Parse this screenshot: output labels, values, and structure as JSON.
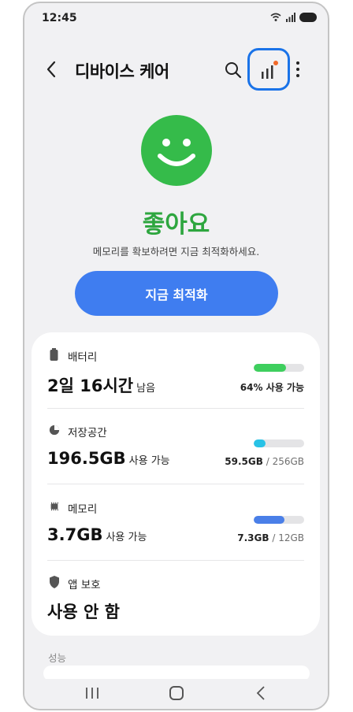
{
  "status_bar": {
    "time": "12:45"
  },
  "app_bar": {
    "title": "디바이스 케어"
  },
  "hero": {
    "status": "좋아요",
    "message": "메모리를 확보하려면 지금 최적화하세요.",
    "button_label": "지금 최적화"
  },
  "items": [
    {
      "label": "배터리",
      "value": "2일 16시간",
      "value_suffix": "남음",
      "info_main": "64% 사용 가능",
      "info_rest": "",
      "fill": 0.64,
      "color": "#3ecf5e"
    },
    {
      "label": "저장공간",
      "value": "196.5GB",
      "value_suffix": "사용 가능",
      "info_main": "59.5GB",
      "info_rest": " / 256GB",
      "fill": 0.23,
      "color": "#28c2e6"
    },
    {
      "label": "메모리",
      "value": "3.7GB",
      "value_suffix": "사용 가능",
      "info_main": "7.3GB",
      "info_rest": " / 12GB",
      "fill": 0.61,
      "color": "#4a7fe8"
    },
    {
      "label": "앱 보호",
      "value": "사용 안 함"
    }
  ],
  "section": {
    "label": "성능"
  },
  "colors": {
    "accent": "#3f7df0",
    "good": "#35bb4a",
    "focus_ring": "#1a73e8",
    "notify_dot": "#f26a2a"
  }
}
